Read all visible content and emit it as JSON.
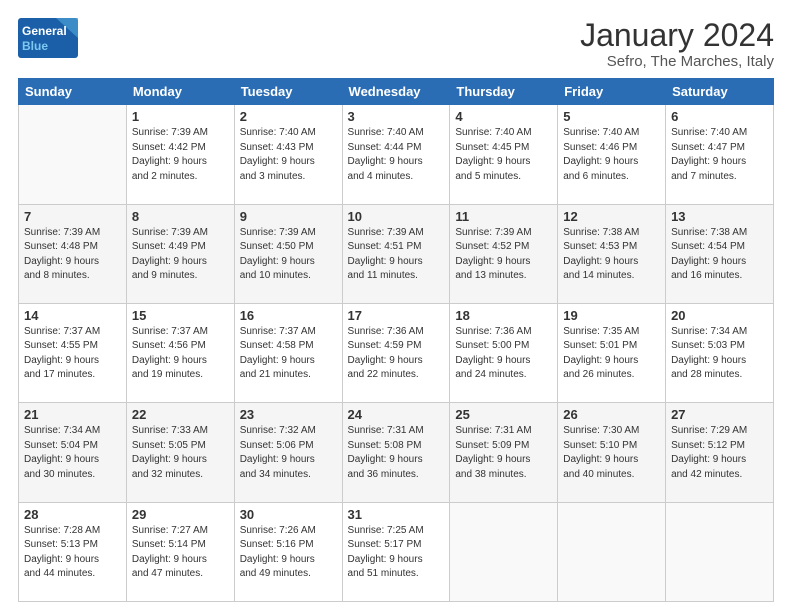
{
  "logo": {
    "line1": "General",
    "line2": "Blue"
  },
  "title": "January 2024",
  "subtitle": "Sefro, The Marches, Italy",
  "days_header": [
    "Sunday",
    "Monday",
    "Tuesday",
    "Wednesday",
    "Thursday",
    "Friday",
    "Saturday"
  ],
  "weeks": [
    [
      {
        "num": "",
        "info": ""
      },
      {
        "num": "1",
        "info": "Sunrise: 7:39 AM\nSunset: 4:42 PM\nDaylight: 9 hours\nand 2 minutes."
      },
      {
        "num": "2",
        "info": "Sunrise: 7:40 AM\nSunset: 4:43 PM\nDaylight: 9 hours\nand 3 minutes."
      },
      {
        "num": "3",
        "info": "Sunrise: 7:40 AM\nSunset: 4:44 PM\nDaylight: 9 hours\nand 4 minutes."
      },
      {
        "num": "4",
        "info": "Sunrise: 7:40 AM\nSunset: 4:45 PM\nDaylight: 9 hours\nand 5 minutes."
      },
      {
        "num": "5",
        "info": "Sunrise: 7:40 AM\nSunset: 4:46 PM\nDaylight: 9 hours\nand 6 minutes."
      },
      {
        "num": "6",
        "info": "Sunrise: 7:40 AM\nSunset: 4:47 PM\nDaylight: 9 hours\nand 7 minutes."
      }
    ],
    [
      {
        "num": "7",
        "info": "Sunrise: 7:39 AM\nSunset: 4:48 PM\nDaylight: 9 hours\nand 8 minutes."
      },
      {
        "num": "8",
        "info": "Sunrise: 7:39 AM\nSunset: 4:49 PM\nDaylight: 9 hours\nand 9 minutes."
      },
      {
        "num": "9",
        "info": "Sunrise: 7:39 AM\nSunset: 4:50 PM\nDaylight: 9 hours\nand 10 minutes."
      },
      {
        "num": "10",
        "info": "Sunrise: 7:39 AM\nSunset: 4:51 PM\nDaylight: 9 hours\nand 11 minutes."
      },
      {
        "num": "11",
        "info": "Sunrise: 7:39 AM\nSunset: 4:52 PM\nDaylight: 9 hours\nand 13 minutes."
      },
      {
        "num": "12",
        "info": "Sunrise: 7:38 AM\nSunset: 4:53 PM\nDaylight: 9 hours\nand 14 minutes."
      },
      {
        "num": "13",
        "info": "Sunrise: 7:38 AM\nSunset: 4:54 PM\nDaylight: 9 hours\nand 16 minutes."
      }
    ],
    [
      {
        "num": "14",
        "info": "Sunrise: 7:37 AM\nSunset: 4:55 PM\nDaylight: 9 hours\nand 17 minutes."
      },
      {
        "num": "15",
        "info": "Sunrise: 7:37 AM\nSunset: 4:56 PM\nDaylight: 9 hours\nand 19 minutes."
      },
      {
        "num": "16",
        "info": "Sunrise: 7:37 AM\nSunset: 4:58 PM\nDaylight: 9 hours\nand 21 minutes."
      },
      {
        "num": "17",
        "info": "Sunrise: 7:36 AM\nSunset: 4:59 PM\nDaylight: 9 hours\nand 22 minutes."
      },
      {
        "num": "18",
        "info": "Sunrise: 7:36 AM\nSunset: 5:00 PM\nDaylight: 9 hours\nand 24 minutes."
      },
      {
        "num": "19",
        "info": "Sunrise: 7:35 AM\nSunset: 5:01 PM\nDaylight: 9 hours\nand 26 minutes."
      },
      {
        "num": "20",
        "info": "Sunrise: 7:34 AM\nSunset: 5:03 PM\nDaylight: 9 hours\nand 28 minutes."
      }
    ],
    [
      {
        "num": "21",
        "info": "Sunrise: 7:34 AM\nSunset: 5:04 PM\nDaylight: 9 hours\nand 30 minutes."
      },
      {
        "num": "22",
        "info": "Sunrise: 7:33 AM\nSunset: 5:05 PM\nDaylight: 9 hours\nand 32 minutes."
      },
      {
        "num": "23",
        "info": "Sunrise: 7:32 AM\nSunset: 5:06 PM\nDaylight: 9 hours\nand 34 minutes."
      },
      {
        "num": "24",
        "info": "Sunrise: 7:31 AM\nSunset: 5:08 PM\nDaylight: 9 hours\nand 36 minutes."
      },
      {
        "num": "25",
        "info": "Sunrise: 7:31 AM\nSunset: 5:09 PM\nDaylight: 9 hours\nand 38 minutes."
      },
      {
        "num": "26",
        "info": "Sunrise: 7:30 AM\nSunset: 5:10 PM\nDaylight: 9 hours\nand 40 minutes."
      },
      {
        "num": "27",
        "info": "Sunrise: 7:29 AM\nSunset: 5:12 PM\nDaylight: 9 hours\nand 42 minutes."
      }
    ],
    [
      {
        "num": "28",
        "info": "Sunrise: 7:28 AM\nSunset: 5:13 PM\nDaylight: 9 hours\nand 44 minutes."
      },
      {
        "num": "29",
        "info": "Sunrise: 7:27 AM\nSunset: 5:14 PM\nDaylight: 9 hours\nand 47 minutes."
      },
      {
        "num": "30",
        "info": "Sunrise: 7:26 AM\nSunset: 5:16 PM\nDaylight: 9 hours\nand 49 minutes."
      },
      {
        "num": "31",
        "info": "Sunrise: 7:25 AM\nSunset: 5:17 PM\nDaylight: 9 hours\nand 51 minutes."
      },
      {
        "num": "",
        "info": ""
      },
      {
        "num": "",
        "info": ""
      },
      {
        "num": "",
        "info": ""
      }
    ]
  ]
}
